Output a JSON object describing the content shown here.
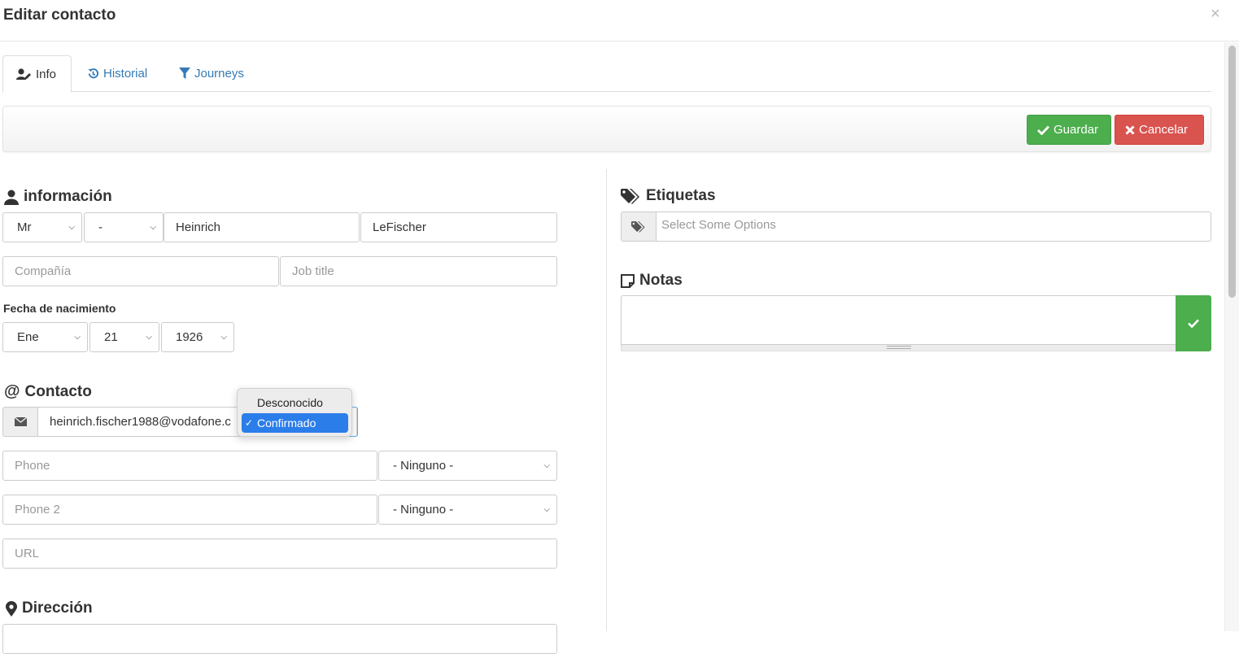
{
  "modal": {
    "title": "Editar contacto",
    "close_glyph": "×"
  },
  "tabs": [
    {
      "label": "Info",
      "icon": "user-edit-icon",
      "active": true
    },
    {
      "label": "Historial",
      "icon": "history-icon",
      "active": false
    },
    {
      "label": "Journeys",
      "icon": "filter-icon",
      "active": false
    }
  ],
  "toolbar": {
    "save_label": "Guardar",
    "cancel_label": "Cancelar"
  },
  "info": {
    "title": "información",
    "salutation": "Mr",
    "middle": "-",
    "first_name": "Heinrich",
    "last_name": "LeFischer",
    "company_placeholder": "Compañía",
    "job_title_placeholder": "Job title",
    "birthdate_label": "Fecha de nacimiento",
    "birth_month": "Ene",
    "birth_day": "21",
    "birth_year": "1926"
  },
  "contacto": {
    "title": "Contacto",
    "email": "heinrich.fischer1988@vodafone.c",
    "phone_placeholder": "Phone",
    "phone_type": "- Ninguno -",
    "phone2_placeholder": "Phone 2",
    "phone2_type": "- Ninguno -",
    "url_placeholder": "URL"
  },
  "email_status_dropdown": {
    "options": [
      "Desconocido",
      "Confirmado"
    ],
    "selected": "Confirmado"
  },
  "direccion": {
    "title": "Dirección"
  },
  "etiquetas": {
    "title": "Etiquetas",
    "placeholder": "Select Some Options"
  },
  "notas": {
    "title": "Notas"
  },
  "colors": {
    "success": "#4cae4c",
    "danger": "#d9534f",
    "link": "#337ab7",
    "selection": "#2b7de9"
  }
}
